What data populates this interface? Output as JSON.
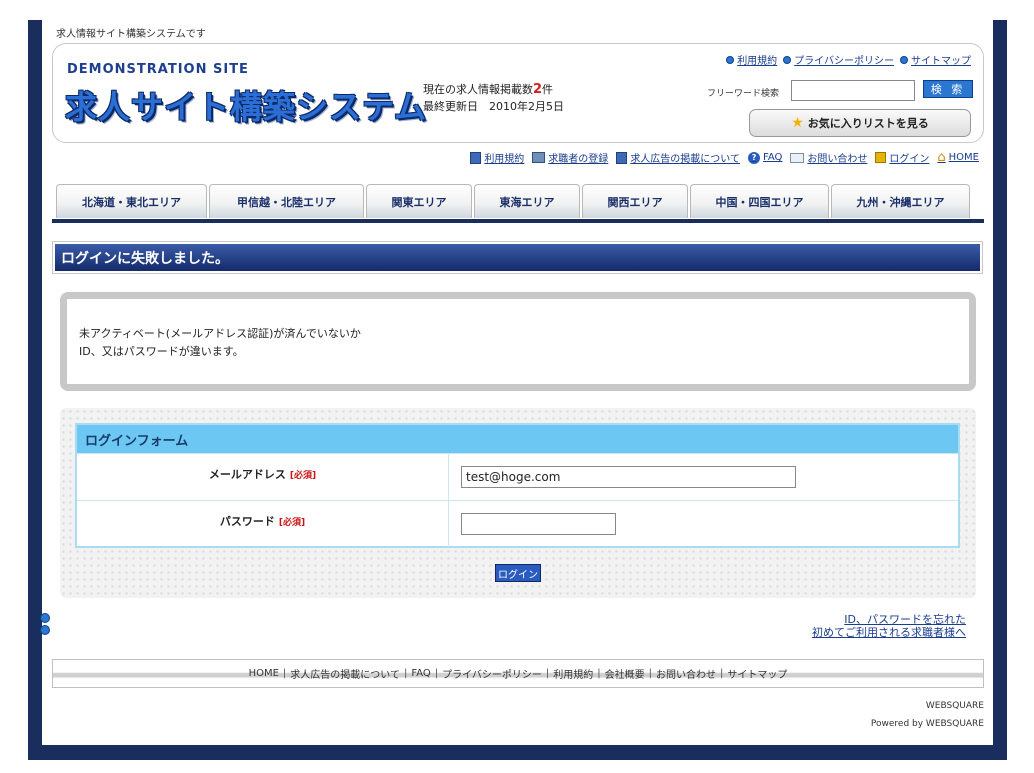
{
  "tagline": "求人情報サイト構築システムです",
  "header": {
    "demo_label": "DEMONSTRATION SITE",
    "logo": "求人サイト構築システム",
    "stats_prefix": "現在の求人情報掲載数",
    "stats_count": "2",
    "stats_suffix": "件",
    "updated": "最終更新日　2010年2月5日",
    "top_links": [
      "利用規約",
      "プライバシーポリシー",
      "サイトマップ"
    ],
    "search_label": "フリーワード検索",
    "search_value": "",
    "search_button": "検 索",
    "favorites_button": "お気に入りリストを見る"
  },
  "subnav": [
    "利用規約",
    "求職者の登録",
    "求人広告の掲載について",
    "FAQ",
    "お問い合わせ",
    "ログイン",
    "HOME"
  ],
  "tabs": [
    "北海道・東北エリア",
    "甲信越・北陸エリア",
    "関東エリア",
    "東海エリア",
    "関西エリア",
    "中国・四国エリア",
    "九州・沖縄エリア"
  ],
  "banner_title": "ログインに失敗しました。",
  "error_lines": [
    "未アクティベート(メールアドレス認証)が済んでいないか",
    "ID、又はパスワードが違います。"
  ],
  "form": {
    "title": "ログインフォーム",
    "email_label": "メールアドレス",
    "password_label": "パスワード",
    "required": "[必須]",
    "email_value": "test@hoge.com",
    "password_value": "",
    "login_button": "ログイン"
  },
  "help_links": [
    "ID、パスワードを忘れた",
    "初めてご利用される求職者様へ"
  ],
  "footer_links": [
    "HOME",
    "求人広告の掲載について",
    "FAQ",
    "プライバシーポリシー",
    "利用規約",
    "会社概要",
    "お問い合わせ",
    "サイトマップ"
  ],
  "copyright1": "WEBSQUARE",
  "copyright2": "Powered by WEBSQUARE",
  "colors": {
    "navy": "#1a2e5e",
    "accent_blue": "#2a76d0",
    "form_header": "#6cc8f2",
    "count_red": "#d81b1b"
  }
}
